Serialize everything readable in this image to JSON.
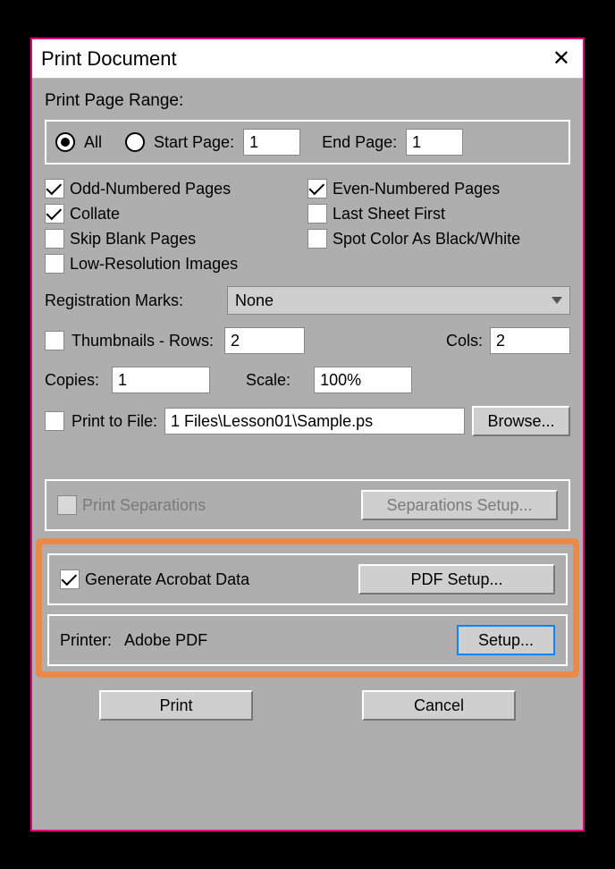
{
  "title": "Print Document",
  "range": {
    "label": "Print Page Range:",
    "all": "All",
    "start_label": "Start Page:",
    "start_value": "1",
    "end_label": "End Page:",
    "end_value": "1"
  },
  "checks": {
    "odd": "Odd-Numbered Pages",
    "even": "Even-Numbered Pages",
    "collate": "Collate",
    "last_first": "Last Sheet First",
    "skip_blank": "Skip Blank Pages",
    "spot_bw": "Spot Color As Black/White",
    "low_res": "Low-Resolution Images"
  },
  "reg_marks": {
    "label": "Registration Marks:",
    "value": "None"
  },
  "thumbs": {
    "label": "Thumbnails - Rows:",
    "rows": "2",
    "cols_label": "Cols:",
    "cols": "2"
  },
  "copies": {
    "label": "Copies:",
    "value": "1"
  },
  "scale": {
    "label": "Scale:",
    "value": "100%"
  },
  "print_file": {
    "label": "Print to File:",
    "path": "1 Files\\Lesson01\\Sample.ps",
    "browse": "Browse..."
  },
  "separations": {
    "label": "Print Separations",
    "setup": "Separations Setup..."
  },
  "acrobat": {
    "label": "Generate Acrobat Data",
    "setup": "PDF Setup..."
  },
  "printer": {
    "label": "Printer:",
    "name": "Adobe PDF",
    "setup": "Setup..."
  },
  "buttons": {
    "print": "Print",
    "cancel": "Cancel"
  }
}
